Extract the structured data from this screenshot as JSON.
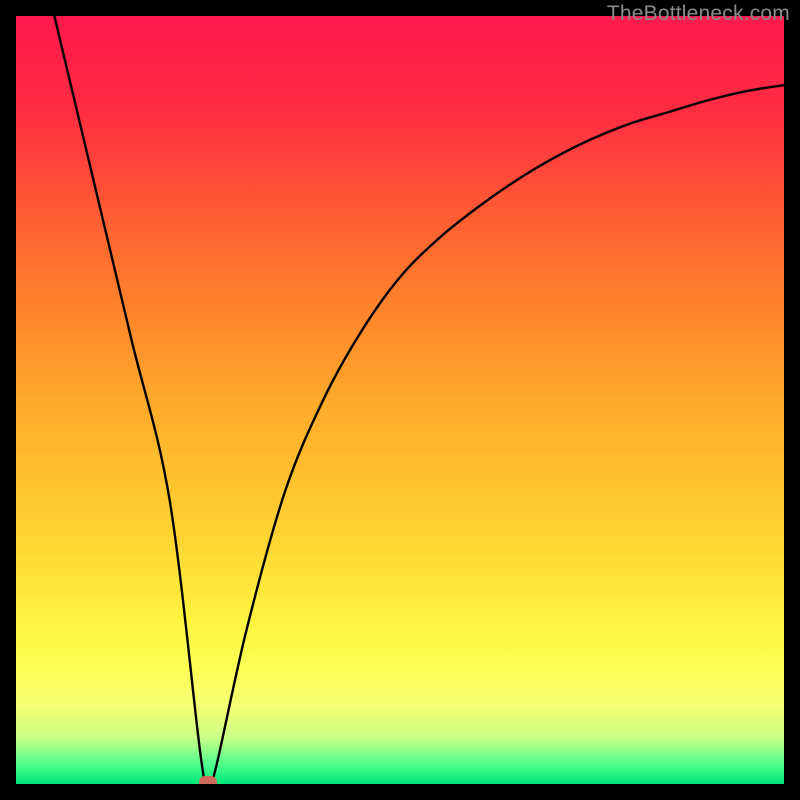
{
  "watermark": "TheBottleneck.com",
  "colors": {
    "frame": "#000000",
    "curve": "#000000",
    "marker": "#cc6a5b",
    "gradient_stops": [
      {
        "offset": 0.0,
        "color": "#ff1a4d"
      },
      {
        "offset": 0.12,
        "color": "#ff2b43"
      },
      {
        "offset": 0.3,
        "color": "#ff6a2f"
      },
      {
        "offset": 0.5,
        "color": "#ffa92a"
      },
      {
        "offset": 0.68,
        "color": "#ffd433"
      },
      {
        "offset": 0.78,
        "color": "#fff23e"
      },
      {
        "offset": 0.85,
        "color": "#feff55"
      },
      {
        "offset": 0.9,
        "color": "#f4ff74"
      },
      {
        "offset": 0.94,
        "color": "#c9ff86"
      },
      {
        "offset": 0.975,
        "color": "#4dff8d"
      },
      {
        "offset": 1.0,
        "color": "#00e57a"
      }
    ]
  },
  "chart_data": {
    "type": "line",
    "title": "",
    "xlabel": "",
    "ylabel": "",
    "xlim": [
      0,
      100
    ],
    "ylim": [
      0,
      100
    ],
    "grid": false,
    "series": [
      {
        "name": "bottleneck-curve",
        "x": [
          5,
          10,
          15,
          20,
          24,
          25,
          26,
          30,
          35,
          40,
          45,
          50,
          55,
          60,
          65,
          70,
          75,
          80,
          85,
          90,
          95,
          100
        ],
        "y": [
          100,
          79,
          58,
          37,
          4,
          0,
          2,
          20,
          38,
          50,
          59,
          66,
          71,
          75,
          78.5,
          81.5,
          84,
          86,
          87.5,
          89,
          90.2,
          91
        ]
      }
    ],
    "annotations": [
      {
        "type": "marker",
        "x": 25,
        "y": 0,
        "name": "optimal-point"
      }
    ]
  }
}
